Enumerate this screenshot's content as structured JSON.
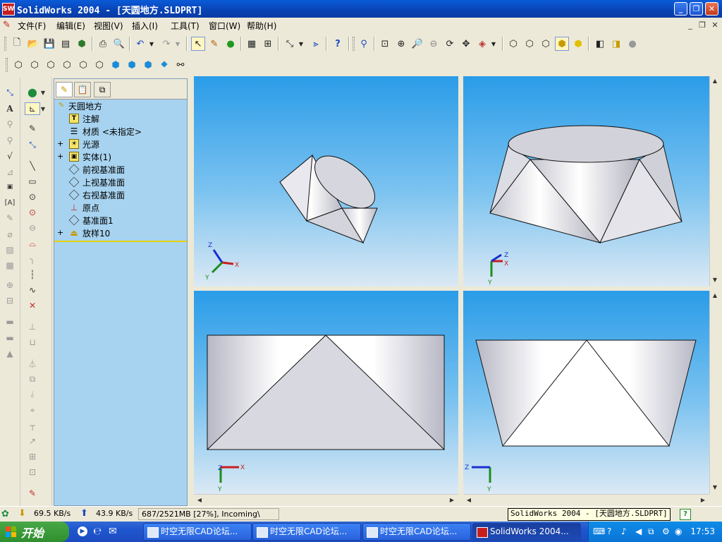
{
  "window": {
    "title": "SolidWorks 2004 - [天圆地方.SLDPRT]",
    "logo_text": "SW"
  },
  "menu": {
    "items": [
      "文件(F)",
      "编辑(E)",
      "视图(V)",
      "插入(I)",
      "工具(T)",
      "窗口(W)",
      "帮助(H)"
    ]
  },
  "toolbar_icons": {
    "standard": [
      "new-icon",
      "open-icon",
      "save-icon",
      "make-drawing-icon",
      "make-assembly-icon",
      "print-icon",
      "print-preview-icon",
      "undo-icon",
      "redo-icon",
      "select-icon",
      "sketch-icon",
      "rebuild-icon",
      "grid-icon",
      "options-icon",
      "smart-dimension-icon",
      "filter-icon",
      "help-icon"
    ],
    "view": [
      "zoom-to-fit-icon",
      "zoom-area-icon",
      "zoom-in-out-icon",
      "zoom-selection-icon",
      "rotate-icon",
      "pan-icon",
      "view-orientation-icon",
      "wireframe-icon",
      "hidden-lines-visible-icon",
      "hidden-lines-removed-icon",
      "shaded-edges-icon",
      "shaded-icon",
      "perspective-icon",
      "section-view-icon",
      "realview-icon"
    ]
  },
  "feature_tree": {
    "tabs": [
      "feature-manager-tab",
      "property-manager-tab",
      "configuration-manager-tab"
    ],
    "root": "天圆地方",
    "items": [
      {
        "label": "注解",
        "icon": "annotations-icon",
        "expand": ""
      },
      {
        "label": "材质 <未指定>",
        "icon": "material-icon",
        "expand": ""
      },
      {
        "label": "光源",
        "icon": "lighting-icon",
        "expand": "+"
      },
      {
        "label": "实体(1)",
        "icon": "solid-bodies-icon",
        "expand": "+"
      },
      {
        "label": "前视基准面",
        "icon": "plane-icon",
        "expand": ""
      },
      {
        "label": "上视基准面",
        "icon": "plane-icon",
        "expand": ""
      },
      {
        "label": "右视基准面",
        "icon": "plane-icon",
        "expand": ""
      },
      {
        "label": "原点",
        "icon": "origin-icon",
        "expand": ""
      },
      {
        "label": "基准面1",
        "icon": "plane-icon",
        "expand": ""
      },
      {
        "label": "放样10",
        "icon": "loft-icon",
        "expand": "+"
      }
    ]
  },
  "viewports": {
    "axis_labels": {
      "x": "X",
      "y": "Y",
      "z": "Z"
    }
  },
  "status": {
    "download": "69.5 KB/s",
    "upload": "43.9 KB/s",
    "memory": "687/2521MB [27%], Incoming\\"
  },
  "tooltip": "SolidWorks 2004 - [天圆地方.SLDPRT]",
  "taskbar": {
    "start": "开始",
    "tasks": [
      {
        "label": "时空无限CAD论坛...",
        "active": false
      },
      {
        "label": "时空无限CAD论坛...",
        "active": false
      },
      {
        "label": "时空无限CAD论坛...",
        "active": false
      },
      {
        "label": "SolidWorks 2004...",
        "active": true
      }
    ],
    "clock": "17:53"
  },
  "colors": {
    "titlebar": "#0842b5",
    "viewport_top": "#2a9ce8",
    "viewport_bottom": "#dbe9f4",
    "tree_bg": "#a7d3f0",
    "taskbar": "#1f56d0"
  }
}
